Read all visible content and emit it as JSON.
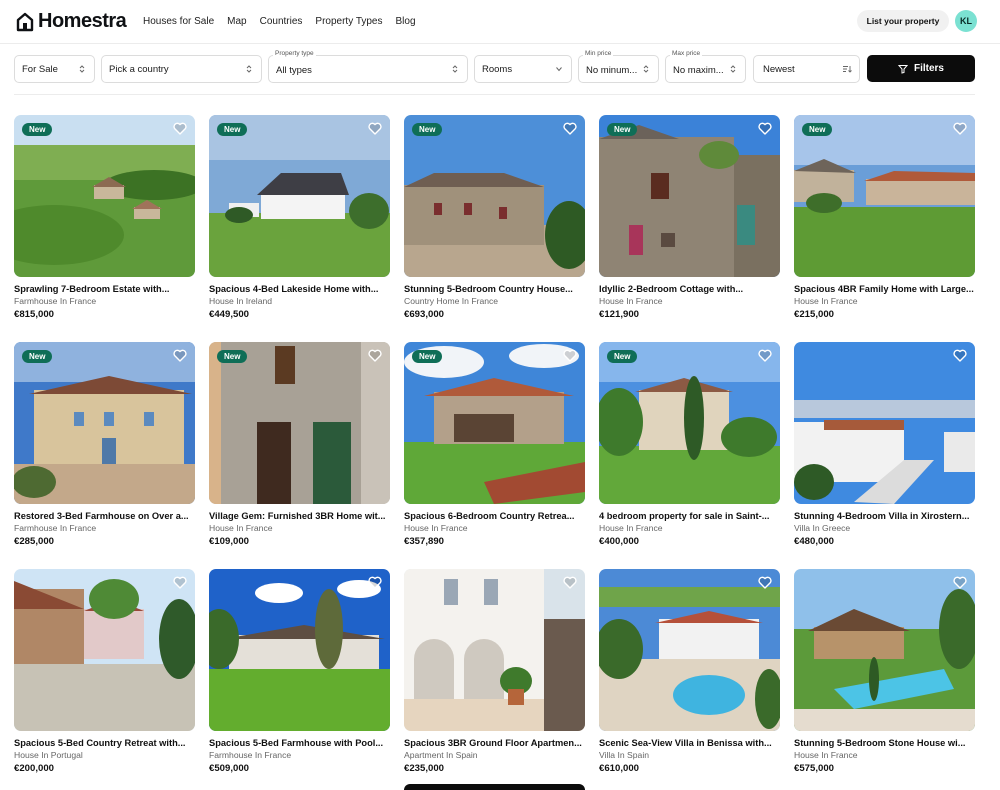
{
  "header": {
    "logo_text": "Homestra",
    "nav": [
      "Houses for Sale",
      "Map",
      "Countries",
      "Property Types",
      "Blog"
    ],
    "list_button": "List your property",
    "avatar_initials": "KL"
  },
  "filters": {
    "listing_type": "For Sale",
    "country": "Pick a country",
    "property_type_label": "Property type",
    "property_type": "All types",
    "rooms": "Rooms",
    "min_price_label": "Min price",
    "min_price": "No minum...",
    "max_price_label": "Max price",
    "max_price": "No maxim...",
    "sort": "Newest",
    "filters_button": "Filters"
  },
  "badge_text": "New",
  "listings": [
    {
      "title": "Sprawling 7-Bedroom Estate with...",
      "sub": "Farmhouse In France",
      "price": "€815,000",
      "is_new": true
    },
    {
      "title": "Spacious 4-Bed Lakeside Home with...",
      "sub": "House In Ireland",
      "price": "€449,500",
      "is_new": true
    },
    {
      "title": "Stunning 5-Bedroom Country House...",
      "sub": "Country Home In France",
      "price": "€693,000",
      "is_new": true
    },
    {
      "title": "Idyllic 2-Bedroom Cottage with...",
      "sub": "House In France",
      "price": "€121,900",
      "is_new": true
    },
    {
      "title": "Spacious 4BR Family Home with Large...",
      "sub": "House In France",
      "price": "€215,000",
      "is_new": true
    },
    {
      "title": "Restored 3-Bed Farmhouse on Over a...",
      "sub": "Farmhouse In France",
      "price": "€285,000",
      "is_new": true
    },
    {
      "title": "Village Gem: Furnished 3BR Home wit...",
      "sub": "House In France",
      "price": "€109,000",
      "is_new": true
    },
    {
      "title": "Spacious 6-Bedroom Country Retrea...",
      "sub": "House In France",
      "price": "€357,890",
      "is_new": true
    },
    {
      "title": "4 bedroom property for sale in Saint-...",
      "sub": "House In France",
      "price": "€400,000",
      "is_new": true
    },
    {
      "title": "Stunning 4-Bedroom Villa in Xirostern...",
      "sub": "Villa In Greece",
      "price": "€480,000",
      "is_new": false
    },
    {
      "title": "Spacious 5-Bed Country Retreat with...",
      "sub": "House In Portugal",
      "price": "€200,000",
      "is_new": false
    },
    {
      "title": "Spacious 5-Bed Farmhouse with Pool...",
      "sub": "Farmhouse In France",
      "price": "€509,000",
      "is_new": false
    },
    {
      "title": "Spacious 3BR Ground Floor Apartmen...",
      "sub": "Apartment In Spain",
      "price": "€235,000",
      "is_new": false
    },
    {
      "title": "Scenic Sea-View Villa in Benissa with...",
      "sub": "Villa In Spain",
      "price": "€610,000",
      "is_new": false
    },
    {
      "title": "Stunning 5-Bedroom Stone House wi...",
      "sub": "House In France",
      "price": "€575,000",
      "is_new": false
    }
  ],
  "colors": {
    "badge": "#0f6e57",
    "avatar": "#7be1d2",
    "primary_button": "#0c0c0c"
  },
  "icons": {
    "heart": "heart-icon",
    "chevron": "chevron-updown-icon",
    "sort": "sort-icon",
    "filter": "filter-icon"
  }
}
